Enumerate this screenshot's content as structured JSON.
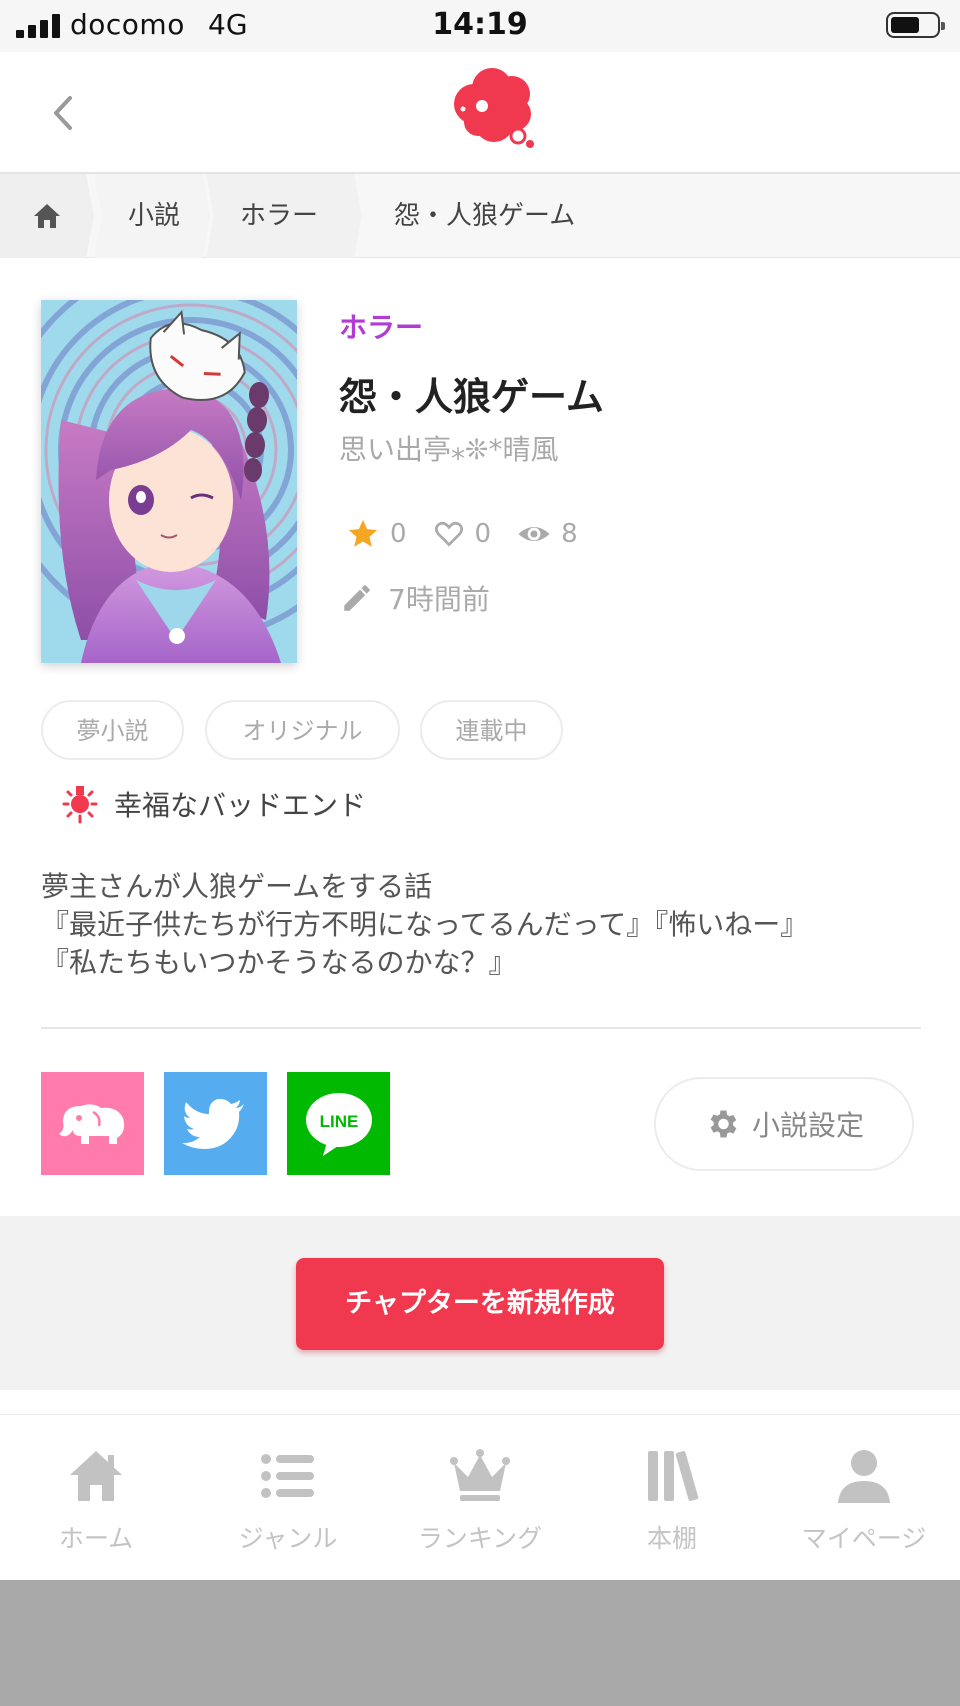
{
  "status_bar": {
    "carrier": "docomo",
    "network": "4G",
    "time": "14:19"
  },
  "breadcrumb": {
    "items": [
      "小説",
      "ホラー",
      "怨・人狼ゲーム"
    ]
  },
  "novel": {
    "genre": "ホラー",
    "title": "怨・人狼ゲーム",
    "author": "思い出亭⁎❊*晴風",
    "stars": "0",
    "likes": "0",
    "views": "8",
    "updated": "7時間前",
    "tags": [
      "夢小説",
      "オリジナル",
      "連載中"
    ],
    "notice": "幸福なバッドエンド",
    "description": [
      "夢主さんが人狼ゲームをする話",
      "『最近子供たちが行方不明になってるんだって』『怖いねー』",
      "『私たちもいつかそうなるのかな？』"
    ]
  },
  "share": {
    "line_label": "LINE",
    "settings_label": "小説設定"
  },
  "actions": {
    "new_chapter": "チャプターを新規作成"
  },
  "tabbar": {
    "items": [
      "ホーム",
      "ジャンル",
      "ランキング",
      "本棚",
      "マイページ"
    ]
  },
  "colors": {
    "accent": "#f0384f",
    "genre": "#b23bd6",
    "line": "#00b900",
    "twitter": "#55acee",
    "share_pink": "#fe7bac",
    "star": "#f5a623"
  },
  "icons": [
    "back-chevron-icon",
    "logo-icon",
    "home-icon",
    "star-icon",
    "heart-icon",
    "eye-icon",
    "pencil-icon",
    "lightbulb-icon",
    "elephant-icon",
    "twitter-bird-icon",
    "line-icon",
    "gear-icon",
    "list-icon",
    "crown-icon",
    "bookshelf-icon",
    "person-icon"
  ]
}
